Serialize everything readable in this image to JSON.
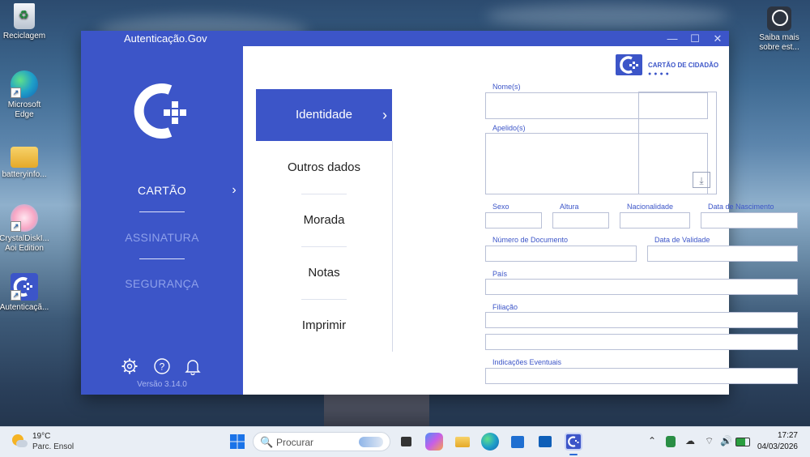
{
  "desktop": {
    "icons": [
      {
        "label": "Reciclagem",
        "icon": "recycle-bin-icon"
      },
      {
        "label": "Microsoft Edge",
        "icon": "edge-icon"
      },
      {
        "label": "batteryinfo...",
        "icon": "folder-icon"
      },
      {
        "label": "CrystalDiskI... Aoi Edition",
        "icon": "crystaldisk-icon"
      },
      {
        "label": "Autenticaçã...",
        "icon": "autenticacao-icon"
      }
    ],
    "right_widget": {
      "label": "Saiba mais sobre est...",
      "icon": "camera-info-icon"
    }
  },
  "window": {
    "title": "Autenticação.Gov",
    "controls": {
      "minimize": "—",
      "maximize": "☐",
      "close": "✕"
    },
    "sidebar": {
      "items": [
        {
          "label": "CARTÃO",
          "active": true
        },
        {
          "label": "ASSINATURA",
          "active": false
        },
        {
          "label": "SEGURANÇA",
          "active": false
        }
      ],
      "chevron": "›",
      "version": "Versão 3.14.0",
      "bottom_icons": [
        "gear-icon",
        "help-icon",
        "bell-icon"
      ]
    },
    "brand": {
      "text": "CARTÃO DE CIDADÃO",
      "dots": "●●●●"
    },
    "subnav": {
      "chevron": "›",
      "items": [
        "Identidade",
        "Outros dados",
        "Morada",
        "Notas",
        "Imprimir"
      ],
      "active": "Identidade"
    },
    "form": {
      "nomes_label": "Nome(s)",
      "nomes_value": "",
      "apelidos_label": "Apelido(s)",
      "apelidos_value": "",
      "sexo_label": "Sexo",
      "sexo_value": "",
      "altura_label": "Altura",
      "altura_value": "",
      "nacionalidade_label": "Nacionalidade",
      "nacionalidade_value": "",
      "nascimento_label": "Data de Nascimento",
      "nascimento_value": "",
      "documento_label": "Número de Documento",
      "documento_value": "",
      "validade_label": "Data de Validade",
      "validade_value": "",
      "pais_label": "País",
      "pais_value": "",
      "filiacao_label": "Filiação",
      "filiacao_value_1": "",
      "filiacao_value_2": "",
      "indicacoes_label": "Indicações Eventuais",
      "indicacoes_value": ""
    },
    "photo": {
      "download_icon": "download-icon",
      "download_glyph": "⤓"
    }
  },
  "taskbar": {
    "weather": {
      "temp": "19°C",
      "condition": "Parc. Ensol"
    },
    "search_placeholder": "Procurar",
    "search_icon": "🔍",
    "apps": [
      "windows-start-icon",
      "task-view-icon",
      "copilot-icon",
      "file-explorer-icon",
      "edge-icon",
      "store-icon",
      "outlook-icon",
      "autenticacao-icon"
    ],
    "tray_icons": [
      "chevron-up-icon",
      "defender-icon",
      "onedrive-icon",
      "wifi-icon",
      "volume-icon",
      "battery-icon"
    ],
    "time": "17:27",
    "date": "04/03/2026"
  }
}
